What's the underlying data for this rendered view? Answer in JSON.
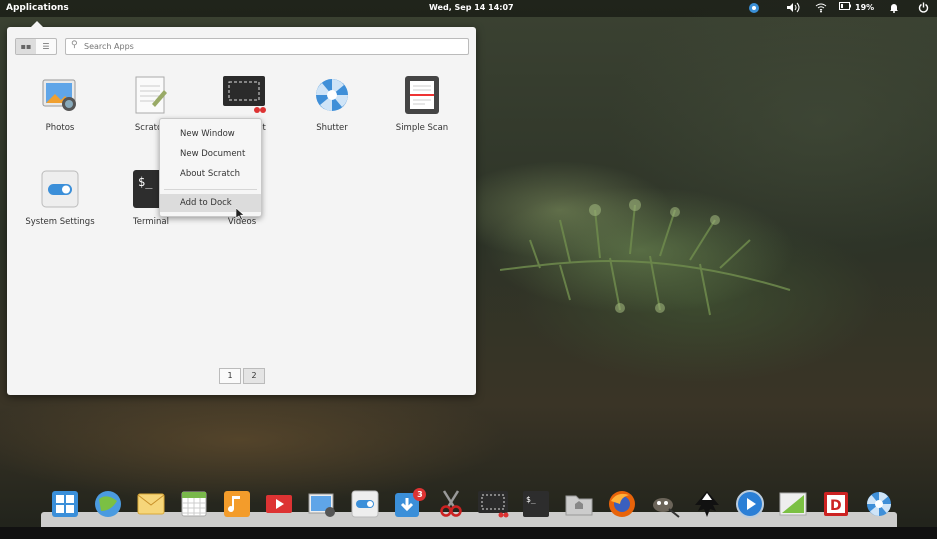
{
  "panel": {
    "applications_label": "Applications",
    "clock": "Wed, Sep 14   14:07",
    "battery": "19%",
    "indicator_icons": [
      "shutter-icon",
      "volume-icon",
      "wifi-icon",
      "battery-icon",
      "notification-bell-icon",
      "power-icon"
    ]
  },
  "launcher": {
    "search_placeholder": "Search Apps",
    "view_modes": [
      "grid-view-icon",
      "category-view-icon"
    ],
    "apps": [
      {
        "label": "Photos",
        "icon": "photos-icon"
      },
      {
        "label": "Scratch",
        "icon": "scratch-icon"
      },
      {
        "label": "Screenshot",
        "icon": "screenshot-icon"
      },
      {
        "label": "Shutter",
        "icon": "shutter-icon"
      },
      {
        "label": "Simple Scan",
        "icon": "simple-scan-icon"
      },
      {
        "label": "System Settings",
        "icon": "system-settings-icon"
      },
      {
        "label": "Terminal",
        "icon": "terminal-icon"
      },
      {
        "label": "Videos",
        "icon": "videos-icon"
      }
    ],
    "pages": [
      "1",
      "2"
    ]
  },
  "context_menu": {
    "items": [
      "New Window",
      "New Document",
      "About Scratch",
      "Add to Dock"
    ],
    "highlighted": "Add to Dock"
  },
  "dock": {
    "items": [
      {
        "icon": "multitasking-view-icon"
      },
      {
        "icon": "midori-browser-icon"
      },
      {
        "icon": "mail-icon"
      },
      {
        "icon": "calendar-icon"
      },
      {
        "icon": "music-icon"
      },
      {
        "icon": "videos-icon"
      },
      {
        "icon": "photos-icon"
      },
      {
        "icon": "system-settings-icon"
      },
      {
        "icon": "appcenter-icon",
        "badge": "3"
      },
      {
        "icon": "scissors-icon"
      },
      {
        "icon": "screenshot-icon"
      },
      {
        "icon": "terminal-icon"
      },
      {
        "icon": "files-icon"
      },
      {
        "icon": "firefox-icon"
      },
      {
        "icon": "gimp-icon"
      },
      {
        "icon": "inkscape-icon"
      },
      {
        "icon": "media-player-icon"
      },
      {
        "icon": "geogebra-icon"
      },
      {
        "icon": "d-app-icon"
      },
      {
        "icon": "shutter-icon"
      }
    ]
  },
  "colors": {
    "accent": "#4a90d9",
    "panel_bg": "rgba(0,0,0,0.45)"
  }
}
